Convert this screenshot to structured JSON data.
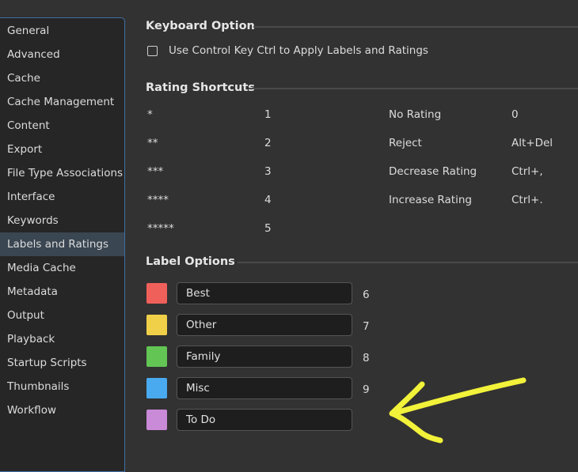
{
  "sidebar": {
    "items": [
      {
        "label": "General"
      },
      {
        "label": "Advanced"
      },
      {
        "label": "Cache"
      },
      {
        "label": "Cache Management"
      },
      {
        "label": "Content"
      },
      {
        "label": "Export"
      },
      {
        "label": "File Type Associations"
      },
      {
        "label": "Interface"
      },
      {
        "label": "Keywords"
      },
      {
        "label": "Labels and Ratings",
        "active": true
      },
      {
        "label": "Media Cache"
      },
      {
        "label": "Metadata"
      },
      {
        "label": "Output"
      },
      {
        "label": "Playback"
      },
      {
        "label": "Startup Scripts"
      },
      {
        "label": "Thumbnails"
      },
      {
        "label": "Workflow"
      }
    ]
  },
  "keyboard_option": {
    "title": "Keyboard Option",
    "checkbox_label": "Use Control Key Ctrl to Apply Labels and Ratings",
    "checked": false
  },
  "rating_shortcuts": {
    "title": "Rating Shortcuts",
    "stars": [
      {
        "stars": "*",
        "key": "1"
      },
      {
        "stars": "**",
        "key": "2"
      },
      {
        "stars": "***",
        "key": "3"
      },
      {
        "stars": "****",
        "key": "4"
      },
      {
        "stars": "*****",
        "key": "5"
      }
    ],
    "actions": [
      {
        "action": "No Rating",
        "key": "0"
      },
      {
        "action": "Reject",
        "key": "Alt+Del"
      },
      {
        "action": "Decrease Rating",
        "key": "Ctrl+,"
      },
      {
        "action": "Increase Rating",
        "key": "Ctrl+."
      }
    ]
  },
  "label_options": {
    "title": "Label Options",
    "labels": [
      {
        "name": "Best",
        "color": "#f0605a",
        "key": "6"
      },
      {
        "name": "Other",
        "color": "#f0d048",
        "key": "7"
      },
      {
        "name": "Family",
        "color": "#62c554",
        "key": "8"
      },
      {
        "name": "Misc",
        "color": "#4aaaf0",
        "key": "9"
      },
      {
        "name": "To Do",
        "color": "#c98ad8",
        "key": ""
      }
    ]
  },
  "colors": {
    "background": "#323232",
    "sidebar_background": "#262626",
    "sidebar_active": "#3a4652",
    "annotation_arrow": "#f2f23a"
  }
}
